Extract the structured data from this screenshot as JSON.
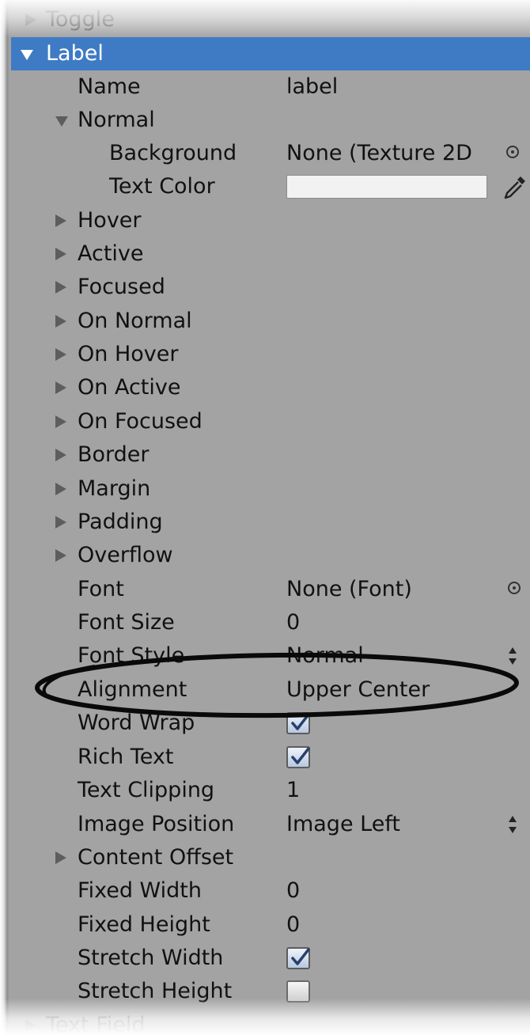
{
  "header_partial_label": "Toggle",
  "footer_partial_label": "Text Field",
  "selected_section_label": "Label",
  "fields": {
    "name": {
      "label": "Name",
      "value": "label"
    },
    "normal": {
      "label": "Normal"
    },
    "background": {
      "label": "Background",
      "value": "None (Texture 2D"
    },
    "text_color": {
      "label": "Text Color",
      "value_hex": "#F2F2F2"
    },
    "hover": {
      "label": "Hover"
    },
    "active": {
      "label": "Active"
    },
    "focused": {
      "label": "Focused"
    },
    "on_normal": {
      "label": "On Normal"
    },
    "on_hover": {
      "label": "On Hover"
    },
    "on_active": {
      "label": "On Active"
    },
    "on_focused": {
      "label": "On Focused"
    },
    "border": {
      "label": "Border"
    },
    "margin": {
      "label": "Margin"
    },
    "padding": {
      "label": "Padding"
    },
    "overflow": {
      "label": "Overflow"
    },
    "font": {
      "label": "Font",
      "value": "None (Font)"
    },
    "font_size": {
      "label": "Font Size",
      "value": "0"
    },
    "font_style": {
      "label": "Font Style",
      "value": "Normal"
    },
    "alignment": {
      "label": "Alignment",
      "value": "Upper Center"
    },
    "word_wrap": {
      "label": "Word Wrap",
      "checked": true
    },
    "rich_text": {
      "label": "Rich Text",
      "checked": true
    },
    "text_clipping": {
      "label": "Text Clipping",
      "value": "1"
    },
    "image_position": {
      "label": "Image Position",
      "value": "Image Left"
    },
    "content_offset": {
      "label": "Content Offset"
    },
    "fixed_width": {
      "label": "Fixed Width",
      "value": "0"
    },
    "fixed_height": {
      "label": "Fixed Height",
      "value": "0"
    },
    "stretch_width": {
      "label": "Stretch Width",
      "checked": true
    },
    "stretch_height": {
      "label": "Stretch Height",
      "checked": false
    }
  },
  "colors": {
    "panel_bg": "#A3A3A3",
    "selection_bg": "#3E7BC4",
    "annotation_ellipse": "#000000"
  }
}
